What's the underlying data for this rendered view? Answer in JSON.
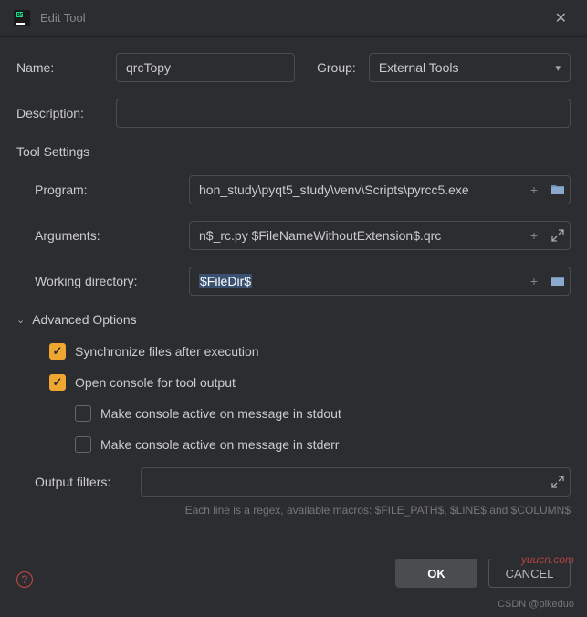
{
  "window": {
    "title": "Edit Tool"
  },
  "form": {
    "name_label": "Name:",
    "name_value": "qrcTopy",
    "group_label": "Group:",
    "group_value": "External Tools",
    "description_label": "Description:",
    "description_value": ""
  },
  "tool_settings": {
    "title": "Tool Settings",
    "program_label": "Program:",
    "program_value": "hon_study\\pyqt5_study\\venv\\Scripts\\pyrcc5.exe",
    "arguments_label": "Arguments:",
    "arguments_value": "n$_rc.py $FileNameWithoutExtension$.qrc",
    "workdir_label": "Working directory:",
    "workdir_value": "$FileDir$"
  },
  "advanced": {
    "title": "Advanced Options",
    "sync_label": "Synchronize files after execution",
    "open_console_label": "Open console for tool output",
    "stdout_label": "Make console active on message in stdout",
    "stderr_label": "Make console active on message in stderr",
    "output_filters_label": "Output filters:",
    "output_filters_value": "",
    "hint": "Each line is a regex, available macros: $FILE_PATH$, $LINE$ and $COLUMN$"
  },
  "buttons": {
    "ok": "OK",
    "cancel": "CANCEL"
  },
  "watermarks": {
    "w1": "yuucn.com",
    "w2": "CSDN @pikeduo"
  },
  "icons": {
    "plus": "+",
    "check": "✓"
  }
}
